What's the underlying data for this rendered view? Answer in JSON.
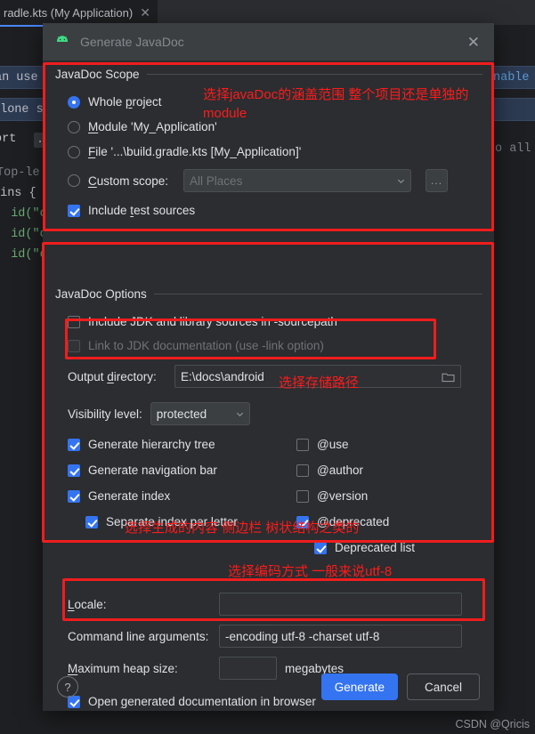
{
  "ide": {
    "tab": {
      "label": "radle.kts (My Application)",
      "close_icon": "close-icon"
    },
    "code_lines": [
      "an use t",
      "alone sc",
      "ort ",
      "..",
      "Top-le",
      "gins {",
      "  id(\"c",
      "  id(\"o",
      "  id(\"o"
    ],
    "right_fragments": [
      "nable au",
      "o all"
    ]
  },
  "dialog": {
    "icon": "android-icon",
    "title": "Generate JavaDoc",
    "close_icon": "close-icon",
    "scope": {
      "group_title": "JavaDoc Scope",
      "options": [
        {
          "label": "Whole project",
          "mnemonic": "p",
          "selected": true
        },
        {
          "label": "Module 'My_Application'",
          "mnemonic": "M",
          "selected": false
        },
        {
          "label": "File '...\\build.gradle.kts [My_Application]'",
          "mnemonic": "F",
          "selected": false
        },
        {
          "label": "Custom scope:",
          "mnemonic": "C",
          "selected": false
        }
      ],
      "custom_scope_value": "All Places",
      "custom_scope_browse": "...",
      "include_test_sources": {
        "label": "Include test sources",
        "checked": true
      }
    },
    "options": {
      "group_title": "JavaDoc Options",
      "include_jdk": {
        "label": "Include JDK and library sources in -sourcepath",
        "checked": false,
        "disabled": false
      },
      "link_jdk": {
        "label": "Link to JDK documentation (use -link option)",
        "checked": false,
        "disabled": true
      },
      "output_directory": {
        "label": "Output directory:",
        "value": "E:\\docs\\android",
        "browse_icon": "folder-icon"
      },
      "visibility": {
        "label": "Visibility level:",
        "value": "protected"
      },
      "left_column": [
        {
          "label": "Generate hierarchy tree",
          "checked": true,
          "indent": 0
        },
        {
          "label": "Generate navigation bar",
          "checked": true,
          "indent": 0
        },
        {
          "label": "Generate index",
          "checked": true,
          "indent": 0
        },
        {
          "label": "Separate index per letter",
          "checked": true,
          "indent": 1
        }
      ],
      "right_column": [
        {
          "label": "@use",
          "checked": false,
          "indent": 0
        },
        {
          "label": "@author",
          "checked": false,
          "indent": 0
        },
        {
          "label": "@version",
          "checked": false,
          "indent": 0
        },
        {
          "label": "@deprecated",
          "checked": true,
          "indent": 0
        },
        {
          "label": "Deprecated list",
          "checked": true,
          "indent": 1
        }
      ]
    },
    "bottom": {
      "locale": {
        "label": "Locale:",
        "mnemonic": "L",
        "value": ""
      },
      "command_line": {
        "label": "Command line arguments:",
        "value": "-encoding utf-8 -charset utf-8"
      },
      "heap": {
        "label": "Maximum heap size:",
        "mnemonic": "M",
        "value": "",
        "unit": "megabytes"
      },
      "open_in_browser": {
        "label": "Open generated documentation in browser",
        "checked": true
      }
    },
    "footer": {
      "help_label": "?",
      "generate_label": "Generate",
      "cancel_label": "Cancel"
    }
  },
  "annotations": {
    "scope_note": "选择javaDoc的涵盖范围 整个项目还是单独的\nmodule",
    "output_note": "选择存储路径",
    "content_note": "选择生成的内容 侧边栏 树状结构之类的",
    "encoding_note": "选择编码方式 一般来说utf-8",
    "color": "#fd1b1b"
  },
  "watermark": "CSDN @Qricis"
}
